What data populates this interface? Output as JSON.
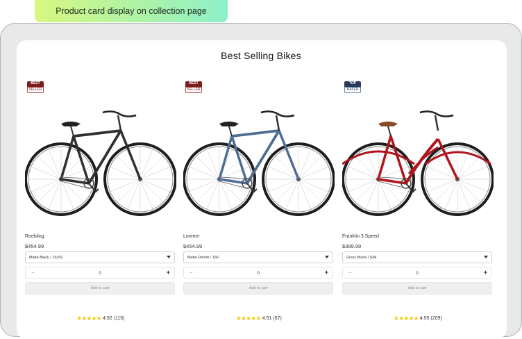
{
  "caption": "Product card display on collection page",
  "section": {
    "title": "Best Selling Bikes"
  },
  "products": [
    {
      "name": "Roebling",
      "price": "$454.99",
      "badge": {
        "line1": "BEST",
        "line2": "SELLER",
        "style": "red"
      },
      "frame_color": "#2e2f33",
      "saddle_color": "#222222",
      "bike_style": "diamond",
      "variant": "Matte Black / 15/XS",
      "quantity": "0",
      "minus_icon": "−",
      "plus_icon": "+",
      "add_to_cart": "Add to cart",
      "stars": "★★★★★",
      "rating": "4.92",
      "reviews": "(115)"
    },
    {
      "name": "Lorimer",
      "price": "$454.99",
      "badge": {
        "line1": "BEST",
        "line2": "SELLER",
        "style": "red"
      },
      "frame_color": "#4f6d91",
      "saddle_color": "#222222",
      "bike_style": "diamond",
      "variant": "Matte Denim / 18/L",
      "quantity": "0",
      "minus_icon": "−",
      "plus_icon": "+",
      "add_to_cart": "Add to cart",
      "stars": "★★★★★",
      "rating": "4.91",
      "reviews": "(67)"
    },
    {
      "name": "Franklin 3 Speed",
      "price": "$389.99",
      "badge": {
        "line1": "TOP",
        "line2": "RATED",
        "style": "navy"
      },
      "frame_color": "#b0141c",
      "saddle_color": "#8a4a28",
      "bike_style": "stepthrough",
      "variant": "Gloss Black / S/M",
      "quantity": "0",
      "minus_icon": "−",
      "plus_icon": "+",
      "add_to_cart": "Add to cart",
      "stars": "★★★★★",
      "rating": "4.95",
      "reviews": "(209)"
    }
  ]
}
